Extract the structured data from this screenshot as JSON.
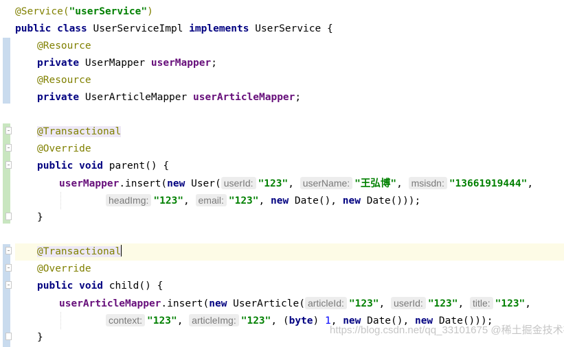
{
  "code": {
    "l1": {
      "ann": "@Service(",
      "str": "\"userService\"",
      "end": ")"
    },
    "l2": {
      "kw1": "public class",
      "name": " UserServiceImpl ",
      "kw2": "implements",
      "rest": " UserService {"
    },
    "l3": {
      "ann": "@Resource"
    },
    "l4": {
      "kw": "private",
      "type": " UserMapper ",
      "fld": "userMapper",
      "end": ";"
    },
    "l5": {
      "ann": "@Resource"
    },
    "l6": {
      "kw": "private",
      "type": " UserArticleMapper ",
      "fld": "userArticleMapper",
      "end": ";"
    },
    "l8": {
      "ann": "@Transactional"
    },
    "l9": {
      "ann": "@Override"
    },
    "l10": {
      "kw": "public void",
      "rest": " parent() {"
    },
    "l11": {
      "fld": "userMapper",
      "call": ".insert(",
      "kw": "new",
      "ctor": " User(",
      "h1": "userId:",
      "s1": "\"123\"",
      "sep1": ", ",
      "h2": "userName:",
      "s2": "\"王弘博\"",
      "sep2": ", ",
      "h3": "msisdn:",
      "s3": "\"13661919444\"",
      "sep3": ","
    },
    "l12": {
      "h1": "headImg:",
      "s1": "\"123\"",
      "sep1": ", ",
      "h2": "email:",
      "s2": "\"123\"",
      "sep2": ", ",
      "kw1": "new",
      "d1": " Date(), ",
      "kw2": "new",
      "d2": " Date()));"
    },
    "l13": {
      "text": "}"
    },
    "l15": {
      "ann": "@Transactional"
    },
    "l16": {
      "ann": "@Override"
    },
    "l17": {
      "kw": "public void",
      "rest": " child() {"
    },
    "l18": {
      "fld": "userArticleMapper",
      "call": ".insert(",
      "kw": "new",
      "ctor": " UserArticle(",
      "h1": "articleId:",
      "s1": "\"123\"",
      "sep1": ", ",
      "h2": "userId:",
      "s2": "\"123\"",
      "sep2": ", ",
      "h3": "title:",
      "s3": "\"123\"",
      "sep3": ","
    },
    "l19": {
      "h1": "context:",
      "s1": "\"123\"",
      "sep1": ", ",
      "h2": "articleImg:",
      "s2": "\"123\"",
      "sep2": ", (",
      "kw1": "byte",
      "cast": ") ",
      "num": "1",
      "sep3": ", ",
      "kw2": "new",
      "d1": " Date(), ",
      "kw3": "new",
      "d2": " Date()));"
    },
    "l20": {
      "text": "}"
    }
  },
  "watermark": "https://blog.csdn.net/qq_33101675  @稀土掘金技术社区",
  "colors": {
    "keyword": "#000080",
    "string": "#008000",
    "field": "#660e7a",
    "annotation": "#808000",
    "number": "#0000ff",
    "change_modified": "#c9dbee",
    "change_added": "#c9e6c0",
    "current_line": "#fdfbe6"
  }
}
